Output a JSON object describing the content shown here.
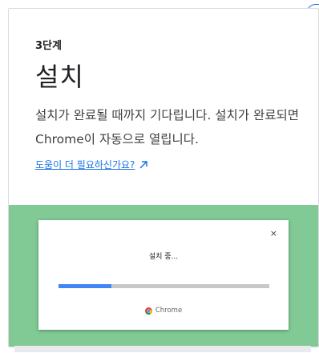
{
  "step": {
    "label": "3단계",
    "title": "설치",
    "description": "설치가 완료될 때까지 기다립니다. 설치가 완료되면 Chrome이 자동으로 열립니다.",
    "help_link": "도움이 더 필요하신가요?"
  },
  "dialog": {
    "close_glyph": "×",
    "status": "설치 중...",
    "progress": 0.25,
    "brand": "Chrome"
  },
  "colors": {
    "accent": "#1a73e8",
    "panel_green": "#81c995",
    "progress_blue": "#4285f4"
  },
  "icons": {
    "external": "arrow-up-right-icon",
    "brand": "chrome-logo-icon",
    "close": "close-icon"
  }
}
